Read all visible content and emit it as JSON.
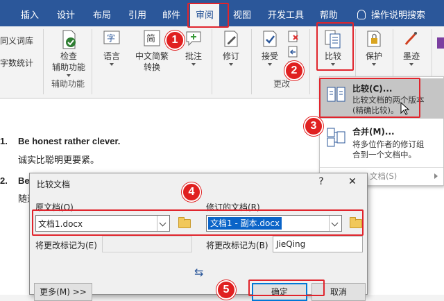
{
  "ribbon_tabs": [
    "插入",
    "设计",
    "布局",
    "引用",
    "邮件",
    "审阅",
    "视图",
    "开发工具",
    "帮助"
  ],
  "active_tab": "审阅",
  "tell_me": "操作说明搜索",
  "ribbon": {
    "left_items": [
      "同义词库",
      "字数统计"
    ],
    "check_accessibility": [
      "检查",
      "辅助功能"
    ],
    "accessibility_group": "辅助功能",
    "language": "语言",
    "chinese_conversion": [
      "中文简繁",
      "转换"
    ],
    "comments": "批注",
    "track_changes": "修订",
    "accept": "接受",
    "changes_group": "更改",
    "compare": "比较",
    "protect": "保护",
    "ink": "墨迹"
  },
  "document": {
    "line1_number": "1.",
    "line1_text": "Be honest rather clever.",
    "line1_translation": "诚实比聪明更要紧。",
    "line2_number": "2.",
    "line2_text": "Bei",
    "line3_text": "随道"
  },
  "compare_menu": {
    "compare_title": "比较(C)...",
    "compare_desc": [
      "比较文档的两个版本",
      "(精确比较)。"
    ],
    "combine_title": "合并(M)...",
    "combine_desc": [
      "将多位作者的修订组",
      "合到一个文档中。"
    ],
    "show_source": "文档(S)"
  },
  "dialog": {
    "title": "比较文档",
    "help": "?",
    "close": "✕",
    "original_label": "原文档(O)",
    "original_value": "文档1.docx",
    "revised_label": "修订的文档(R)",
    "revised_value": "文档1 - 副本.docx",
    "label_changes_left": "将更改标记为(E)",
    "label_changes_right": "将更改标记为(B)",
    "author_value": "JieQing",
    "swap": "⇆",
    "more_button": "更多(M) >>",
    "ok_button": "确定",
    "cancel_button": "取消"
  },
  "callouts": [
    "1",
    "2",
    "3",
    "4",
    "5"
  ],
  "colors": {
    "ribbon_blue": "#2b579a",
    "annotation_red": "#e0242c",
    "selection_blue": "#0a64c8"
  }
}
